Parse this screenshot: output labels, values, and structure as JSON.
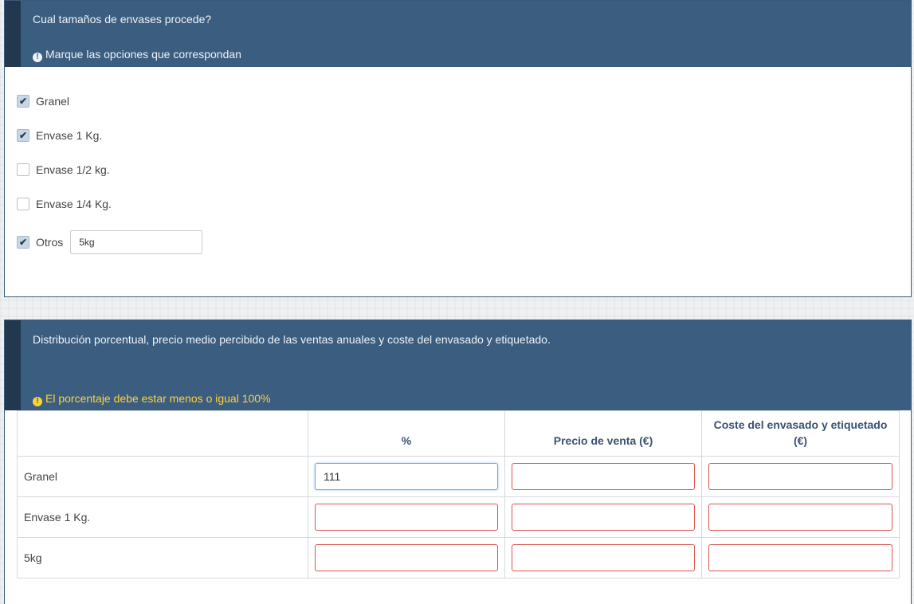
{
  "question1": {
    "title": "Cual tamaños de envases procede?",
    "note": "Marque las opciones que correspondan",
    "options": [
      {
        "label": "Granel",
        "checked": true
      },
      {
        "label": "Envase 1 Kg.",
        "checked": true
      },
      {
        "label": "Envase 1/2 kg.",
        "checked": false
      },
      {
        "label": "Envase 1/4 Kg.",
        "checked": false
      },
      {
        "label": "Otros",
        "checked": true
      }
    ],
    "other_value": "5kg"
  },
  "question2": {
    "title": "Distribución porcentual, precio medio percibido de las ventas anuales y coste del envasado y etiquetado.",
    "warning": "El porcentaje debe estar menos o igual 100%",
    "columns": [
      "",
      "%",
      "Precio de venta (€)",
      "Coste del envasado y etiquetado (€)"
    ],
    "rows": [
      {
        "label": "Granel",
        "values": [
          "111",
          "",
          ""
        ]
      },
      {
        "label": "Envase 1 Kg.",
        "values": [
          "",
          "",
          ""
        ]
      },
      {
        "label": "5kg",
        "values": [
          "",
          "",
          ""
        ]
      }
    ]
  },
  "colors": {
    "header_bg": "#3b5d80",
    "header_accent": "#22384f",
    "warning": "#ffd23a",
    "error_border": "#d9534f",
    "focus_border": "#66a8e8"
  }
}
